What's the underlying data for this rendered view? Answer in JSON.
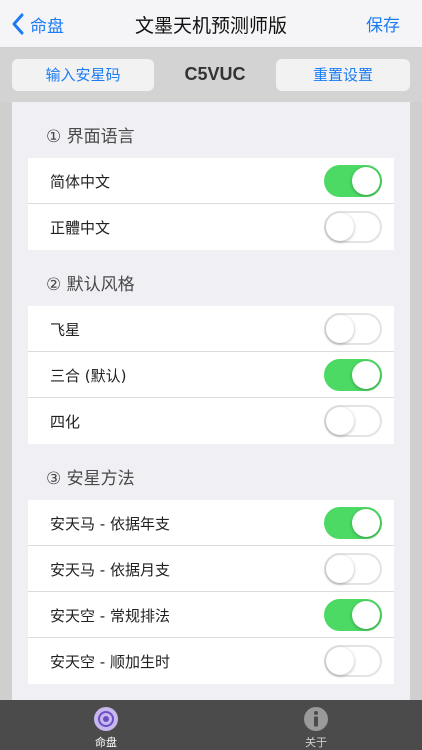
{
  "nav": {
    "back_label": "命盘",
    "title": "文墨天机预测师版",
    "save_label": "保存"
  },
  "toolbar": {
    "input_code_label": "输入安星码",
    "code": "C5VUC",
    "reset_label": "重置设置"
  },
  "sections": [
    {
      "header": "① 界面语言",
      "rows": [
        {
          "label": "简体中文",
          "on": true
        },
        {
          "label": "正體中文",
          "on": false
        }
      ]
    },
    {
      "header": "② 默认风格",
      "rows": [
        {
          "label": "飞星",
          "on": false
        },
        {
          "label": "三合 (默认)",
          "on": true
        },
        {
          "label": "四化",
          "on": false
        }
      ]
    },
    {
      "header": "③ 安星方法",
      "rows": [
        {
          "label": "安天马 - 依据年支",
          "on": true
        },
        {
          "label": "安天马 - 依据月支",
          "on": false
        },
        {
          "label": "安天空 - 常规排法",
          "on": true
        },
        {
          "label": "安天空 - 顺加生时",
          "on": false
        }
      ]
    }
  ],
  "tabs": [
    {
      "label": "命盘",
      "icon": "disc-icon",
      "active": true
    },
    {
      "label": "关于",
      "icon": "info-icon",
      "active": false
    }
  ],
  "colors": {
    "accent": "#1c7cf4",
    "toggle_on": "#4cd964",
    "tabbar": "#4b4b4b"
  }
}
